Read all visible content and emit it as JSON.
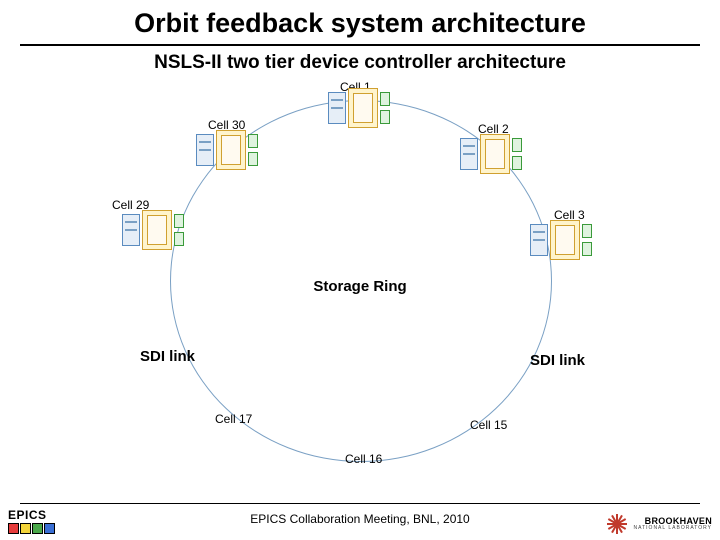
{
  "title": "Orbit feedback system architecture",
  "subtitle": "NSLS-II two tier device controller architecture",
  "ring_label": "Storage Ring",
  "cells": {
    "c1": "Cell 1",
    "c2": "Cell 2",
    "c3": "Cell 3",
    "c15": "Cell 15",
    "c16": "Cell 16",
    "c17": "Cell 17",
    "c29": "Cell 29",
    "c30": "Cell 30"
  },
  "sdi": {
    "left": "SDI link",
    "right": "SDI link"
  },
  "footer": "EPICS Collaboration Meeting, BNL, 2010",
  "logos": {
    "epics": "EPICS",
    "bnl_line1": "BROOKHAVEN",
    "bnl_line2": "NATIONAL LABORATORY"
  }
}
